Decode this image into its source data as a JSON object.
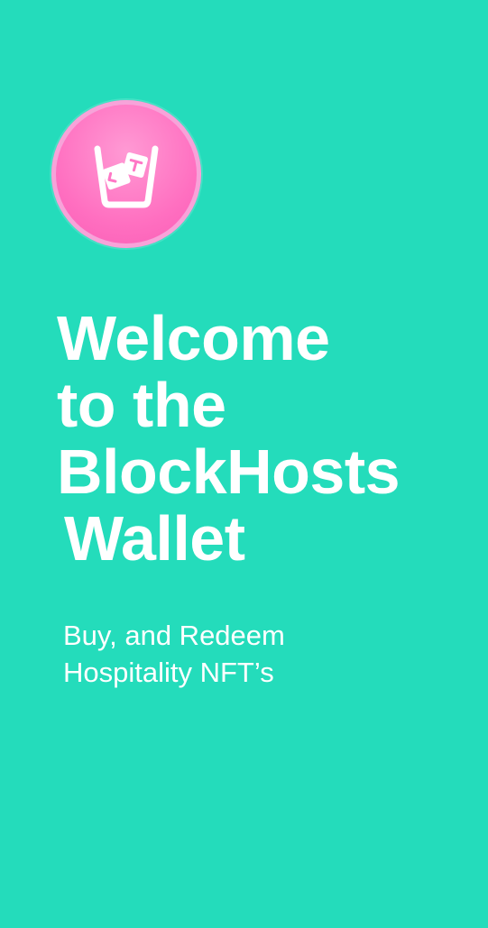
{
  "app": {
    "logo_icon": "blockhosts-glass-ice-icon",
    "accent_background": "#24dcbb",
    "logo_color": "#ff77c6"
  },
  "welcome": {
    "lines": [
      "Welcome",
      "to the",
      "BlockHosts",
      "Wallet"
    ]
  },
  "tagline": {
    "lines": [
      "Buy, and Redeem",
      "Hospitality NFT’s"
    ]
  }
}
